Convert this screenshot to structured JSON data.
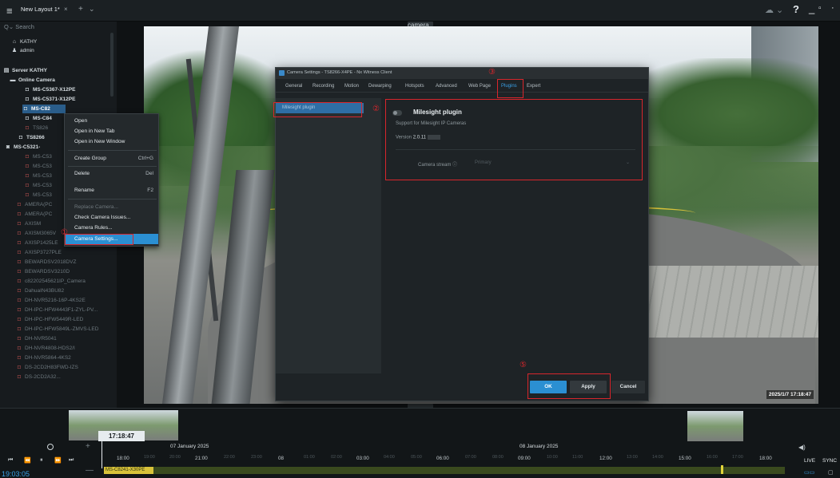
{
  "topbar": {
    "menu_icon": "hamburger-icon",
    "tab_label": "New Layout 1*",
    "tab_close": "×",
    "add_tab": "+",
    "tab_menu": "⌄",
    "cloud": "☁ ⌄",
    "help": "?",
    "minimize": "_",
    "maximize": "▫",
    "close": "·"
  },
  "sidebar": {
    "search_placeholder": "Search",
    "items": [
      {
        "label": "KATHY",
        "icon": "home-icon"
      },
      {
        "label": "admin",
        "icon": "user-icon"
      },
      {
        "label": "Server KATHY",
        "icon": "server-icon"
      },
      {
        "label": "Online Camera",
        "icon": "folder-icon"
      },
      {
        "label": "MS-C5367-X12PE",
        "icon": "camera-icon"
      },
      {
        "label": "MS-C5371-X12PE",
        "icon": "camera-icon"
      },
      {
        "label": "MS-C82",
        "icon": "camera-icon"
      },
      {
        "label": "MS-C84",
        "icon": "camera-icon"
      },
      {
        "label": "TS826",
        "icon": "camera-icon"
      },
      {
        "label": "TS8266",
        "icon": "camera-icon"
      },
      {
        "label": "MS-C5321-",
        "icon": "camera-group-icon"
      },
      {
        "label": "MS-C53",
        "icon": "camera-icon"
      },
      {
        "label": "MS-C53",
        "icon": "camera-icon"
      },
      {
        "label": "MS-C53",
        "icon": "camera-icon"
      },
      {
        "label": "MS-C53",
        "icon": "camera-icon"
      },
      {
        "label": "MS-C53",
        "icon": "camera-icon"
      },
      {
        "label": "AMERA(PC",
        "icon": "camera-icon"
      },
      {
        "label": "AMERA(PC",
        "icon": "camera-icon"
      },
      {
        "label": "AXISM",
        "icon": "camera-icon"
      },
      {
        "label": "AXISM3065V",
        "icon": "camera-icon"
      },
      {
        "label": "AXISP1425LE",
        "icon": "camera-icon"
      },
      {
        "label": "AXISP3727PLE",
        "icon": "camera-icon"
      },
      {
        "label": "BEWARDSV2018DVZ",
        "icon": "camera-icon"
      },
      {
        "label": "BEWARDSV3210D",
        "icon": "camera-icon"
      },
      {
        "label": "c82202545621IP_Camera",
        "icon": "camera-icon"
      },
      {
        "label": "DahuaIN43BU82",
        "icon": "camera-icon"
      },
      {
        "label": "DH-NVR5216-16P-4KS2E",
        "icon": "camera-icon"
      },
      {
        "label": "DH-IPC-HFW4443F1-ZYL-PV...",
        "icon": "camera-icon"
      },
      {
        "label": "DH-IPC-HFW5449R-LED",
        "icon": "camera-icon"
      },
      {
        "label": "DH-IPC-HFW5849L-ZMVS-LED",
        "icon": "camera-icon"
      },
      {
        "label": "DH-NVR5041",
        "icon": "camera-icon"
      },
      {
        "label": "DH-NVR4808-HDS2/I",
        "icon": "camera-icon"
      },
      {
        "label": "DH-NVR5864-4KS2",
        "icon": "camera-icon"
      },
      {
        "label": "DS-2CD2H83FWD-IZS",
        "icon": "camera-icon"
      },
      {
        "label": "DS-2CD2A32...",
        "icon": "camera-icon"
      }
    ]
  },
  "context_menu": {
    "items": [
      {
        "label": "Open",
        "shortcut": ""
      },
      {
        "label": "Open in New Tab",
        "shortcut": ""
      },
      {
        "label": "Open in New Window",
        "shortcut": ""
      },
      {
        "label": "Create Group",
        "shortcut": "Ctrl+G"
      },
      {
        "label": "Delete",
        "shortcut": "Del"
      },
      {
        "label": "Rename",
        "shortcut": "F2"
      },
      {
        "label": "Replace Camera...",
        "shortcut": ""
      },
      {
        "label": "Check Camera Issues...",
        "shortcut": ""
      },
      {
        "label": "Camera Rules...",
        "shortcut": ""
      },
      {
        "label": "Camera Settings...",
        "shortcut": ""
      }
    ]
  },
  "video": {
    "header_label": "camera",
    "timestamp": "2025/1/7 17:18:47"
  },
  "dialog": {
    "title": "Camera Settings - TS8266-X4PE - Nx Witness Client",
    "tabs": [
      "General",
      "Recording",
      "Motion",
      "Dewarping",
      "Hotspots",
      "Advanced",
      "Web Page",
      "Plugins",
      "Expert"
    ],
    "active_tab": "Plugins",
    "plugin_list": [
      "Milesight plugin"
    ],
    "plugin_title": "Milesight plugin",
    "plugin_desc": "Support for Milesight IP Cameras",
    "version_label": "Version",
    "version_value": "2.0.11",
    "camera_stream_label": "Camera stream",
    "camera_stream_value": "Primary",
    "ok_label": "OK",
    "apply_label": "Apply",
    "cancel_label": "Cancel"
  },
  "annotations": {
    "n1": "①",
    "n2": "②",
    "n3": "③",
    "n5": "⑤"
  },
  "timeline": {
    "current_time": "17:18:47",
    "clock": "19:03:05",
    "dates": [
      "07 January 2025",
      "08 January 2025"
    ],
    "hours": [
      "18:00",
      "21:00",
      "08",
      "03:00",
      "06:00",
      "09:00",
      "12:00",
      "15:00",
      "18:00"
    ],
    "minor_hours": [
      "19:00",
      "20:00",
      "22:00",
      "23:00",
      "01:00",
      "02:00",
      "04:00",
      "05:00",
      "07:00",
      "08:00",
      "10:00",
      "11:00",
      "13:00",
      "14:00",
      "16:00",
      "17:00"
    ],
    "camera_label": "MS-C8241-X30PE",
    "live": "LIVE",
    "sync": "SYNC",
    "controls": [
      "⏮",
      "⏪",
      "⏸",
      "⏩",
      "⏭"
    ]
  }
}
